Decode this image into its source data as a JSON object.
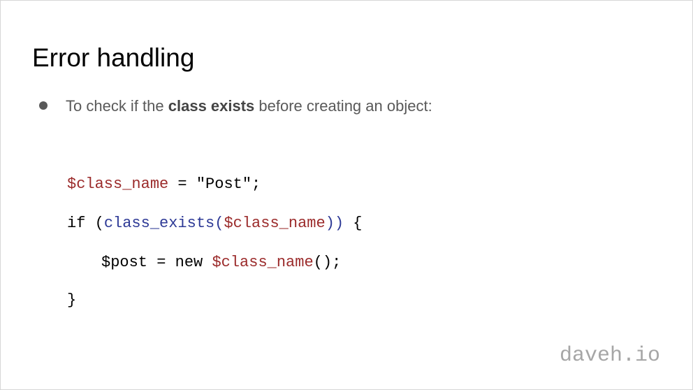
{
  "slide": {
    "title": "Error handling",
    "bullet": {
      "before": "To check if the ",
      "bold": "class exists",
      "after": " before creating an object:"
    },
    "code": {
      "line1": {
        "var": "$class_name",
        "rest": " = \"Post\";"
      },
      "line2": {
        "keyword": "if (",
        "func": "class_exists(",
        "var": "$class_name",
        "close": "))",
        "brace": " {"
      },
      "line3": {
        "prefix": "$post = new ",
        "var": "$class_name",
        "suffix": "();"
      },
      "line4": {
        "text": "}"
      }
    },
    "watermark": "daveh.io"
  },
  "colors": {
    "variable": "#9b2b2b",
    "function": "#2e3a96",
    "bullet_text": "#595959",
    "watermark": "#a6a6a6"
  }
}
